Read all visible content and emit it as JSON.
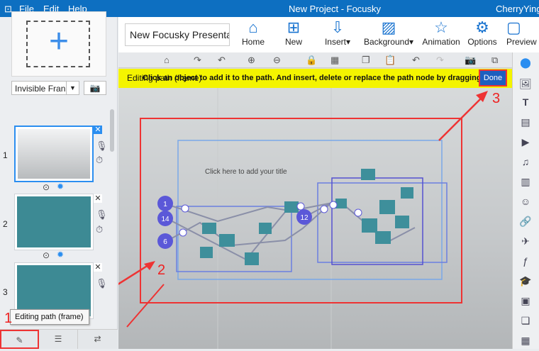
{
  "titlebar": {
    "menu": [
      "File",
      "Edit",
      "Help"
    ],
    "title": "New Project - Focusky",
    "user": "CherryYinge"
  },
  "left": {
    "frame_type": "Invisible Fran",
    "slides": [
      "1",
      "2",
      "3"
    ],
    "tooltip": "Editing path (frame)"
  },
  "ribbon": {
    "doc_name": "New Focusky Presenta",
    "buttons": [
      "Home",
      "New",
      "Insert",
      "Background",
      "Animation",
      "Options",
      "Preview"
    ]
  },
  "banner": {
    "text_a": "Editing path (frame)",
    "text_b": "Click an object to add it to the path. And insert, delete or replace the path node by dragging",
    "done": "Done"
  },
  "canvas": {
    "title_placeholder": "Click here to add your title",
    "path_nodes": [
      "1",
      "14",
      "6",
      "12"
    ]
  },
  "annotations": [
    "1",
    "2",
    "3"
  ],
  "colors": {
    "titlebar": "#0d6fc1",
    "accent": "#2b8ef0",
    "banner": "#f4f400",
    "annotation": "#e22222"
  }
}
